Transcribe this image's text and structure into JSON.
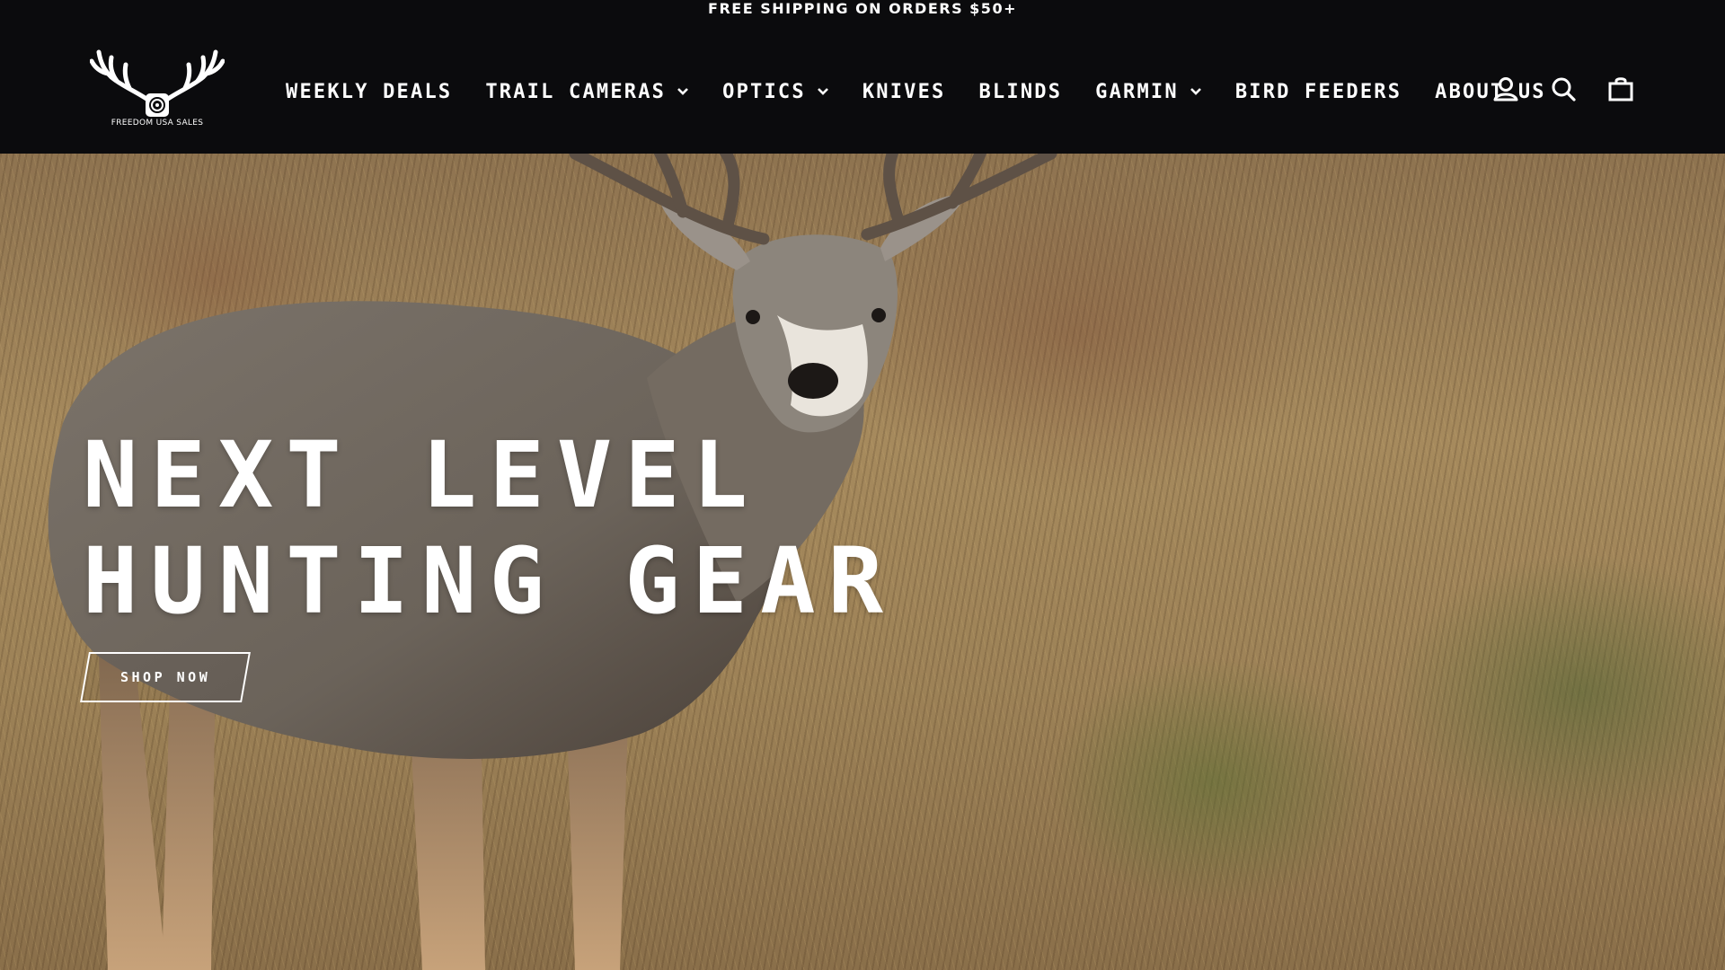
{
  "announcement": "FREE SHIPPING ON ORDERS $50+",
  "brand": {
    "name": "FREEDOM USA SALES",
    "logo_icon": "antlers-target-icon"
  },
  "nav": {
    "items": [
      {
        "label": "WEEKLY DEALS",
        "has_dropdown": false
      },
      {
        "label": "TRAIL CAMERAS",
        "has_dropdown": true
      },
      {
        "label": "OPTICS",
        "has_dropdown": true
      },
      {
        "label": "KNIVES",
        "has_dropdown": false
      },
      {
        "label": "BLINDS",
        "has_dropdown": false
      },
      {
        "label": "GARMIN",
        "has_dropdown": true
      },
      {
        "label": "BIRD FEEDERS",
        "has_dropdown": false
      },
      {
        "label": "ABOUT US",
        "has_dropdown": false
      }
    ]
  },
  "header_icons": [
    "user-icon",
    "search-icon",
    "cart-icon"
  ],
  "hero": {
    "title_line1": "NEXT LEVEL",
    "title_line2": "HUNTING GEAR",
    "button_label": "SHOP NOW",
    "image": "mule-deer-buck-in-grass"
  },
  "colors": {
    "header_bg": "#0b0b0d",
    "text": "#ffffff"
  }
}
